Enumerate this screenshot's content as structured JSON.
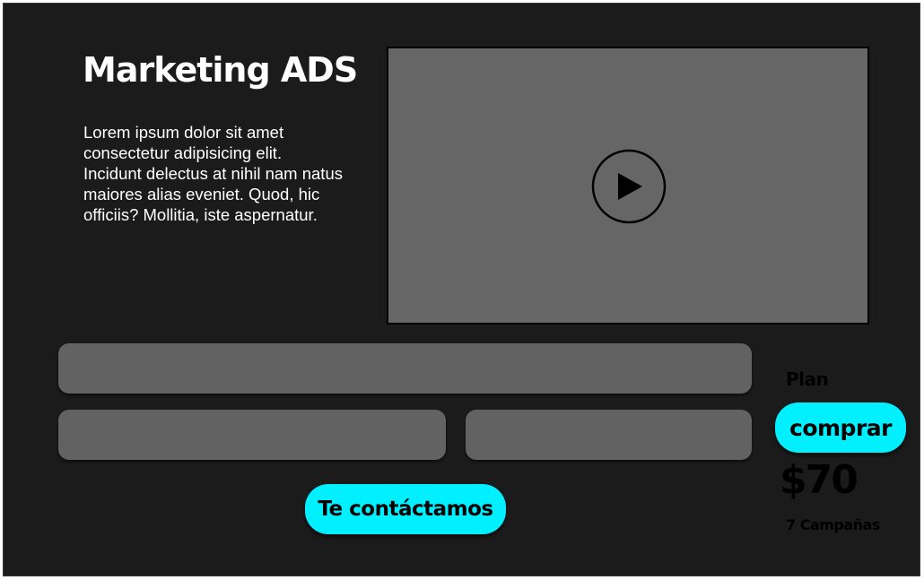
{
  "hero": {
    "title": "Marketing ADS",
    "description": "Lorem ipsum dolor sit amet consectetur adipisicing elit. Incidunt delectus at nihil nam natus maiores alias eveniet. Quod, hic officiis? Mollitia, iste aspernatur."
  },
  "video": {
    "icon": "play-icon"
  },
  "contact_form": {
    "field_1_value": "",
    "field_2_value": "",
    "field_3_value": "",
    "submit_label": "Te contáctamos"
  },
  "plan": {
    "label": "Plan",
    "buy_label": "comprar",
    "price": "$70",
    "campaigns": "7 Campañas"
  },
  "colors": {
    "background": "#1b1b1b",
    "accent": "#00f0ff",
    "placeholder_gray": "#666666"
  }
}
